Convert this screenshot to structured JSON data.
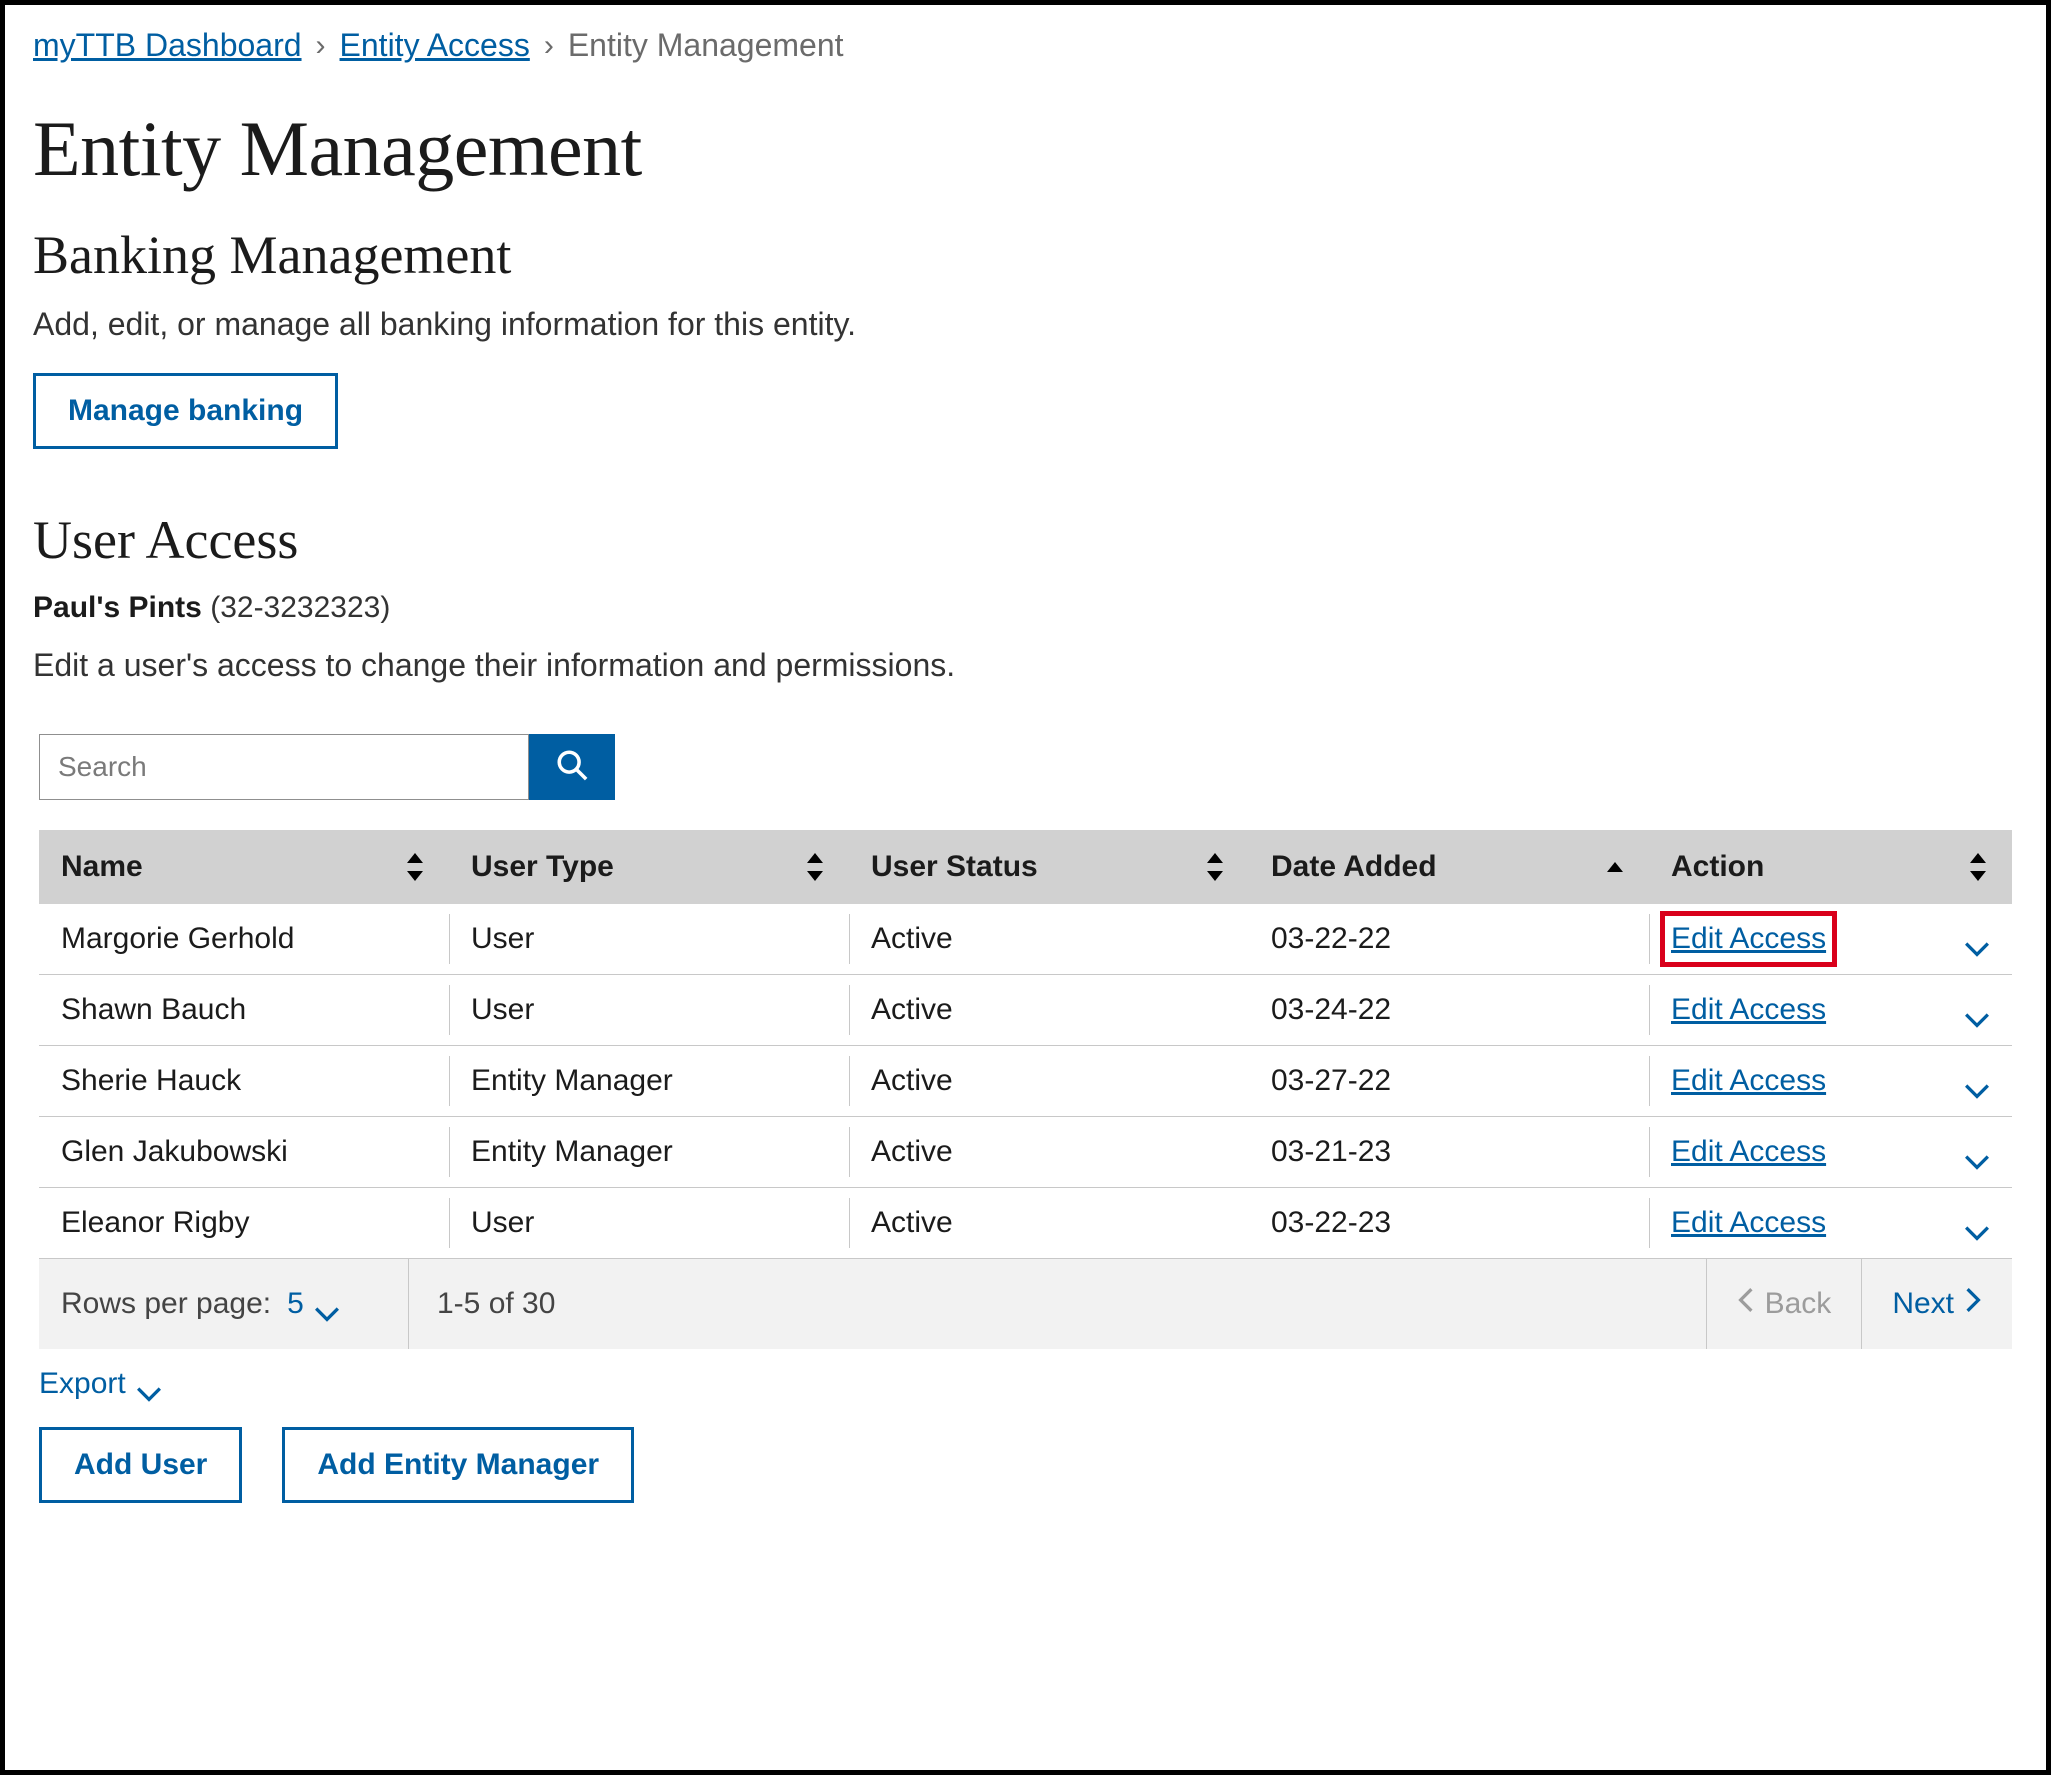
{
  "breadcrumb": {
    "items": [
      {
        "label": "myTTB Dashboard",
        "link": true
      },
      {
        "label": "Entity Access",
        "link": true
      },
      {
        "label": "Entity Management",
        "link": false
      }
    ]
  },
  "page": {
    "title": "Entity Management"
  },
  "banking": {
    "heading": "Banking Management",
    "description": "Add, edit, or manage all banking information for this entity.",
    "button": "Manage banking"
  },
  "userAccess": {
    "heading": "User Access",
    "entityName": "Paul's Pints",
    "entityId": "(32-3232323)",
    "description": "Edit a user's access to change their information and permissions."
  },
  "search": {
    "placeholder": "Search"
  },
  "table": {
    "columns": {
      "name": "Name",
      "type": "User Type",
      "status": "User Status",
      "date": "Date Added",
      "action": "Action"
    },
    "editLabel": "Edit Access",
    "rows": [
      {
        "name": "Margorie Gerhold",
        "type": "User",
        "status": "Active",
        "date": "03-22-22",
        "highlight": true
      },
      {
        "name": "Shawn Bauch",
        "type": "User",
        "status": "Active",
        "date": "03-24-22",
        "highlight": false
      },
      {
        "name": "Sherie Hauck",
        "type": "Entity Manager",
        "status": "Active",
        "date": "03-27-22",
        "highlight": false
      },
      {
        "name": "Glen Jakubowski",
        "type": "Entity Manager",
        "status": "Active",
        "date": "03-21-23",
        "highlight": false
      },
      {
        "name": "Eleanor Rigby",
        "type": "User",
        "status": "Active",
        "date": "03-22-23",
        "highlight": false
      }
    ]
  },
  "pagination": {
    "rowsPerPageLabel": "Rows per page:",
    "rowsPerPageValue": "5",
    "rangeLabel": "1-5 of 30",
    "backLabel": "Back",
    "nextLabel": "Next"
  },
  "exportLabel": "Export",
  "buttons": {
    "addUser": "Add User",
    "addEntityManager": "Add Entity Manager"
  }
}
